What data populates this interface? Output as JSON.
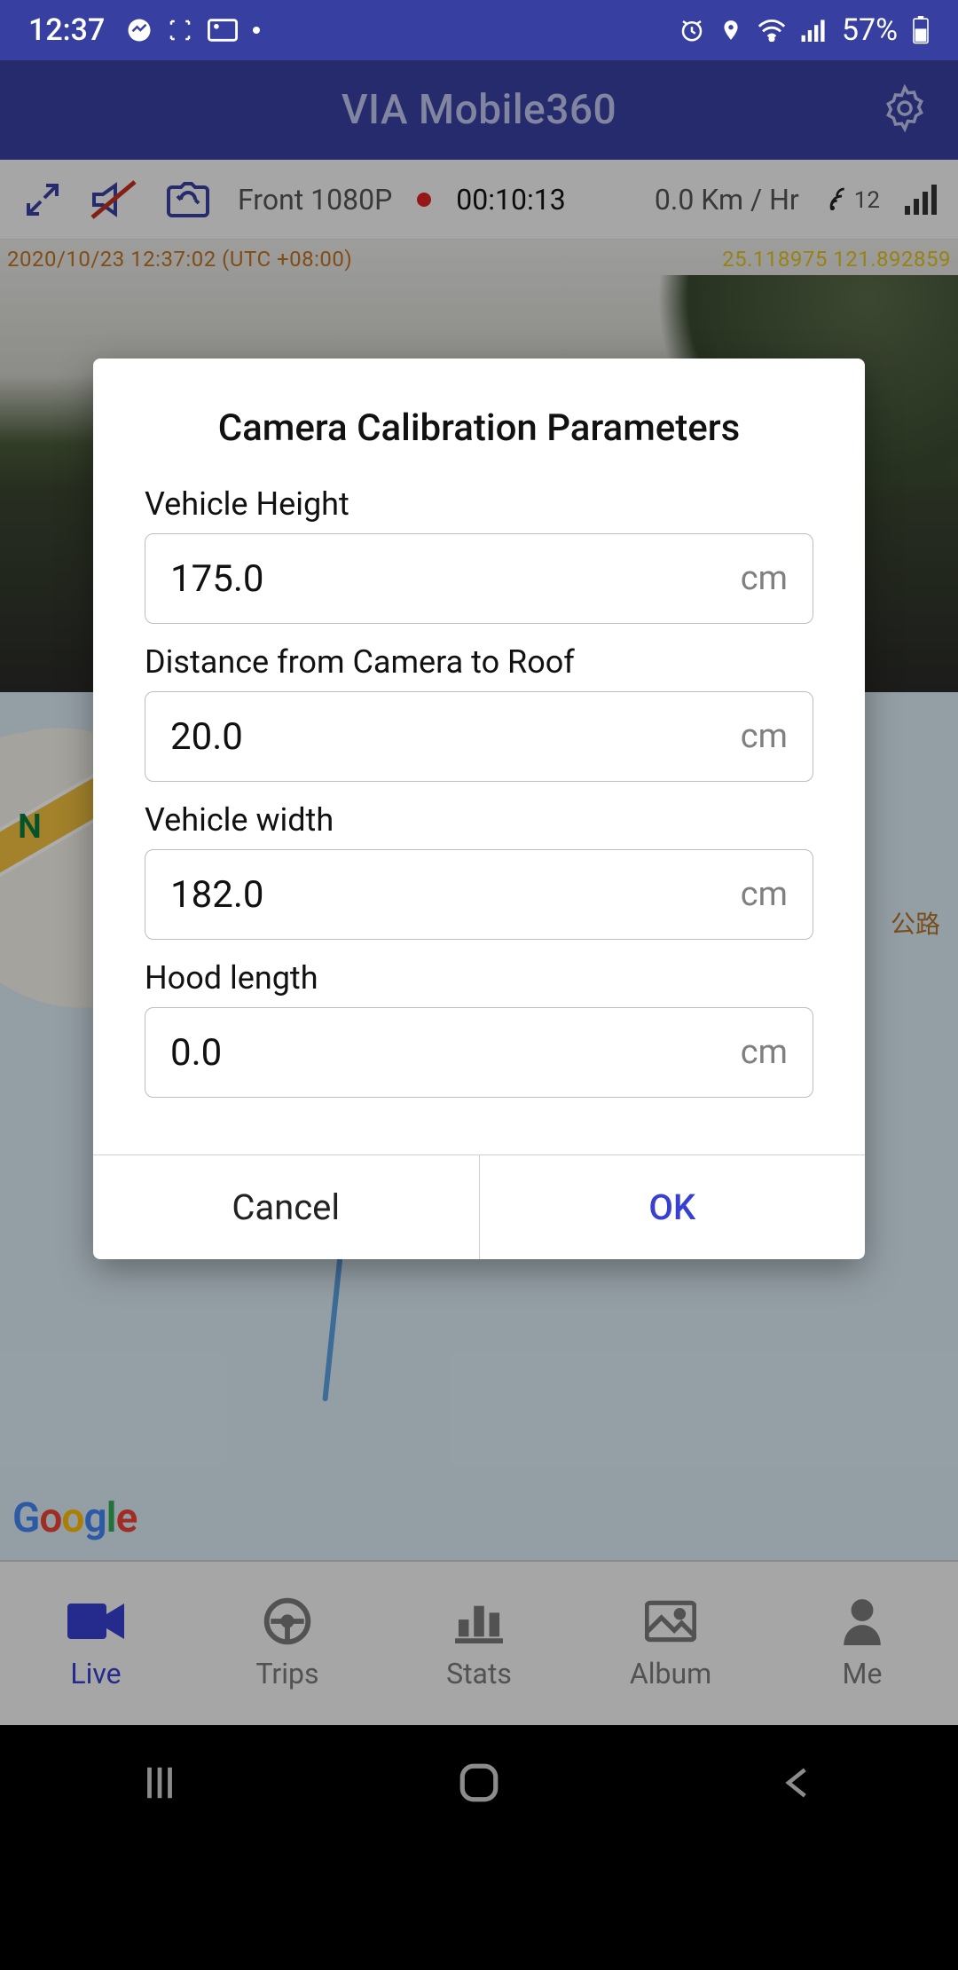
{
  "status_bar": {
    "time": "12:37",
    "battery_text": "57%",
    "icons_left": [
      "messenger-icon",
      "scan-icon",
      "landscape-icon",
      "dot-icon"
    ],
    "icons_right": [
      "alarm-icon",
      "location-icon",
      "wifi-icon",
      "cell-icon"
    ]
  },
  "app_header": {
    "title": "VIA Mobile360"
  },
  "toolbar": {
    "camera_label": "Front 1080P",
    "timer": "00:10:13",
    "speed": "0.0 Km / Hr",
    "satellites": "12"
  },
  "camera_overlay": {
    "timestamp_left": "2020/10/23  12:37:02  (UTC +08:00)",
    "coords_right": "25.118975 121.892859"
  },
  "map": {
    "north_label": "N",
    "road_label": "公路",
    "google_label": "Google"
  },
  "dialog": {
    "title": "Camera Calibration Parameters",
    "fields": [
      {
        "label": "Vehicle Height",
        "value": "175.0",
        "unit": "cm"
      },
      {
        "label": "Distance from Camera to Roof",
        "value": "20.0",
        "unit": "cm"
      },
      {
        "label": "Vehicle width",
        "value": "182.0",
        "unit": "cm"
      },
      {
        "label": "Hood length",
        "value": "0.0",
        "unit": "cm"
      }
    ],
    "cancel": "Cancel",
    "ok": "OK"
  },
  "tabs": [
    {
      "id": "live",
      "label": "Live",
      "active": true
    },
    {
      "id": "trips",
      "label": "Trips",
      "active": false
    },
    {
      "id": "stats",
      "label": "Stats",
      "active": false
    },
    {
      "id": "album",
      "label": "Album",
      "active": false
    },
    {
      "id": "me",
      "label": "Me",
      "active": false
    }
  ]
}
